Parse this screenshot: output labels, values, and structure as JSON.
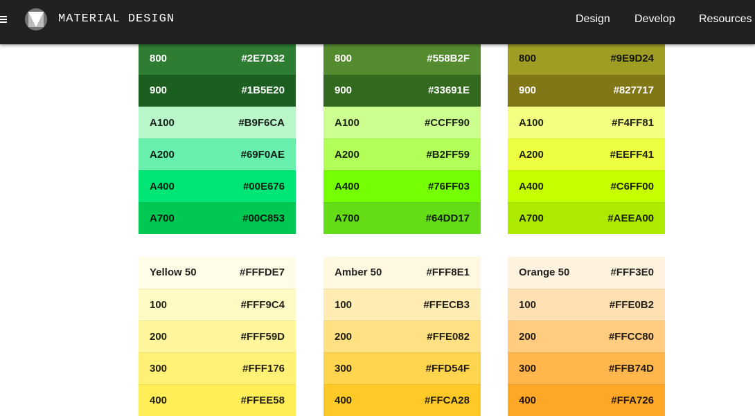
{
  "header": {
    "brand": "MATERIAL DESIGN",
    "tabs": [
      {
        "label": "Design",
        "active": true
      },
      {
        "label": "Develop",
        "active": false
      },
      {
        "label": "Resources",
        "active": false
      }
    ],
    "background": "#212121"
  },
  "palettes": [
    {
      "rows": [
        {
          "name": "800",
          "hex": "#2E7D32"
        },
        {
          "name": "900",
          "hex": "#1B5E20"
        },
        {
          "name": "A100",
          "hex": "#B9F6CA"
        },
        {
          "name": "A200",
          "hex": "#69F0AE"
        },
        {
          "name": "A400",
          "hex": "#00E676"
        },
        {
          "name": "A700",
          "hex": "#00C853"
        }
      ]
    },
    {
      "rows": [
        {
          "name": "800",
          "hex": "#558B2F"
        },
        {
          "name": "900",
          "hex": "#33691E"
        },
        {
          "name": "A100",
          "hex": "#CCFF90"
        },
        {
          "name": "A200",
          "hex": "#B2FF59"
        },
        {
          "name": "A400",
          "hex": "#76FF03"
        },
        {
          "name": "A700",
          "hex": "#64DD17"
        }
      ]
    },
    {
      "rows": [
        {
          "name": "800",
          "hex": "#9E9D24"
        },
        {
          "name": "900",
          "hex": "#827717"
        },
        {
          "name": "A100",
          "hex": "#F4FF81"
        },
        {
          "name": "A200",
          "hex": "#EEFF41"
        },
        {
          "name": "A400",
          "hex": "#C6FF00"
        },
        {
          "name": "A700",
          "hex": "#AEEA00"
        }
      ]
    },
    {
      "rows": [
        {
          "name": "Yellow 50",
          "hex": "#FFFDE7"
        },
        {
          "name": "100",
          "hex": "#FFF9C4"
        },
        {
          "name": "200",
          "hex": "#FFF59D"
        },
        {
          "name": "300",
          "hex": "#FFF176"
        },
        {
          "name": "400",
          "hex": "#FFEE58"
        }
      ]
    },
    {
      "rows": [
        {
          "name": "Amber 50",
          "hex": "#FFF8E1"
        },
        {
          "name": "100",
          "hex": "#FFECB3"
        },
        {
          "name": "200",
          "hex": "#FFE082"
        },
        {
          "name": "300",
          "hex": "#FFD54F"
        },
        {
          "name": "400",
          "hex": "#FFCA28"
        }
      ]
    },
    {
      "rows": [
        {
          "name": "Orange 50",
          "hex": "#FFF3E0"
        },
        {
          "name": "100",
          "hex": "#FFE0B2"
        },
        {
          "name": "200",
          "hex": "#FFCC80"
        },
        {
          "name": "300",
          "hex": "#FFB74D"
        },
        {
          "name": "400",
          "hex": "#FFA726"
        }
      ]
    }
  ]
}
